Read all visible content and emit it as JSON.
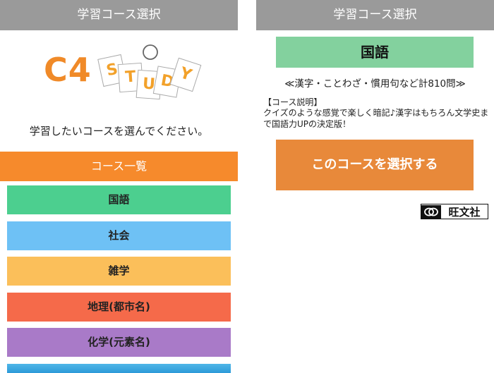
{
  "left_screen": {
    "title": "学習コース選択",
    "logo": {
      "main_text": "C4",
      "letters": [
        "S",
        "T",
        "U",
        "D",
        "Y"
      ]
    },
    "prompt": "学習したいコースを選んでください。",
    "list_header": "コース一覧",
    "courses": [
      {
        "label": "国語",
        "color": "#4ccf8f"
      },
      {
        "label": "社会",
        "color": "#6ec1f5"
      },
      {
        "label": "雑学",
        "color": "#fbbf5a"
      },
      {
        "label": "地理(都市名)",
        "color": "#f56a4a"
      },
      {
        "label": "化学(元素名)",
        "color": "#a97ac8"
      }
    ]
  },
  "right_screen": {
    "title": "学習コース選択",
    "subject": "国語",
    "summary": "≪漢字・ことわざ・慣用句など計810問≫",
    "description_label": "【コース説明】",
    "description": "クイズのような感覚で楽しく暗記♪漢字はもちろん文学史まで国語力UPの決定版！",
    "select_button": "このコースを選択する",
    "publisher": "旺文社"
  },
  "colors": {
    "titlebar": "#9a9a9a",
    "orange_accent": "#f68a2c",
    "select_button": "#e8893a",
    "subject_banner": "#83d19e"
  }
}
